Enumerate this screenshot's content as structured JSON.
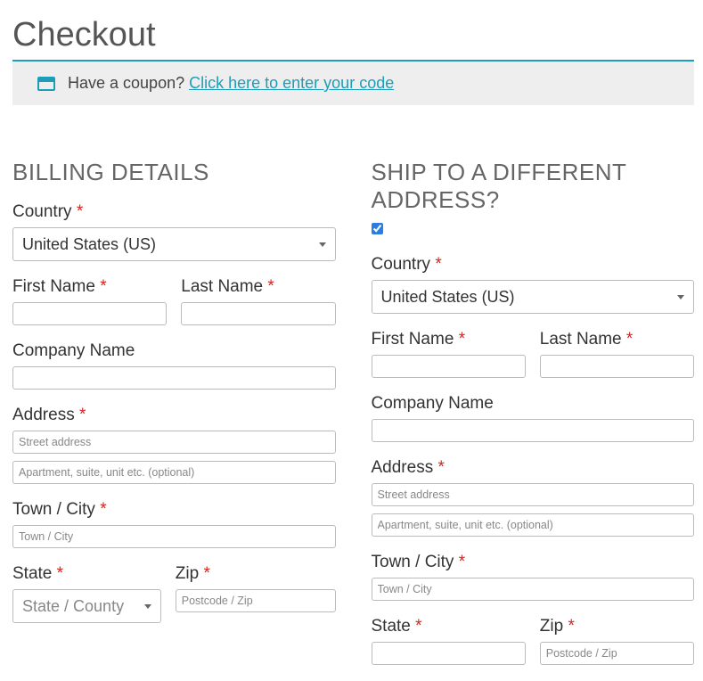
{
  "page_title": "Checkout",
  "coupon": {
    "prompt": "Have a coupon? ",
    "link": "Click here to enter your code"
  },
  "billing": {
    "heading": "BILLING DETAILS",
    "country_label": "Country ",
    "country_value": "United States (US)",
    "first_name_label": "First Name ",
    "last_name_label": "Last Name ",
    "company_label": "Company Name",
    "address_label": "Address ",
    "address_ph1": "Street address",
    "address_ph2": "Apartment, suite, unit etc. (optional)",
    "town_label": "Town / City ",
    "town_ph": "Town / City",
    "state_label": "State ",
    "state_placeholder": "State / County",
    "zip_label": "Zip ",
    "zip_ph": "Postcode / Zip"
  },
  "shipping": {
    "heading": "SHIP TO A DIFFERENT ADDRESS?",
    "checked": true,
    "country_label": "Country ",
    "country_value": "United States (US)",
    "first_name_label": "First Name ",
    "last_name_label": "Last Name ",
    "company_label": "Company Name",
    "address_label": "Address ",
    "address_ph1": "Street address",
    "address_ph2": "Apartment, suite, unit etc. (optional)",
    "town_label": "Town / City ",
    "town_ph": "Town / City",
    "state_label": "State ",
    "zip_label": "Zip ",
    "zip_ph": "Postcode / Zip"
  },
  "required_mark": "*"
}
